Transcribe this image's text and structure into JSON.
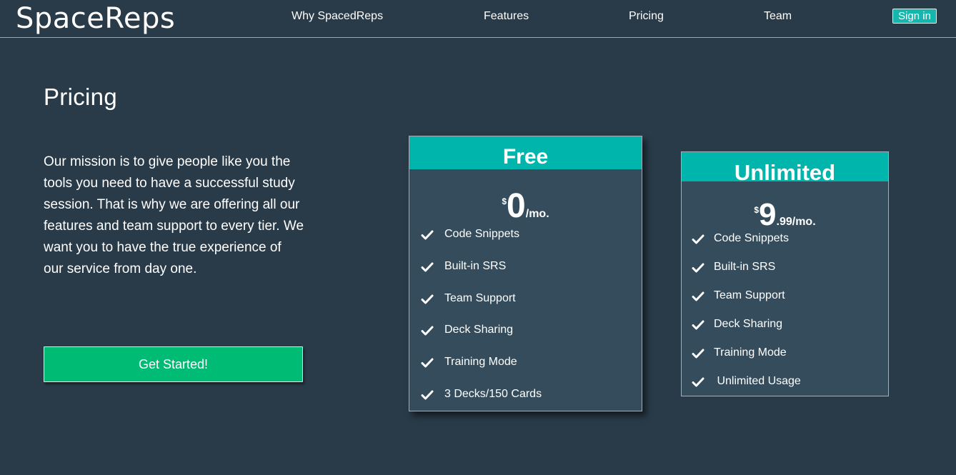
{
  "nav": {
    "logo": "SpaceReps",
    "links": [
      "Why SpacedReps",
      "Features",
      "Pricing",
      "Team"
    ],
    "sign_in": "Sign in"
  },
  "hero": {
    "title": "Pricing",
    "mission": "Our mission is to give people like you the tools you need to have a successful study session. That is why we are offering all our features and team support to every tier. We want you to have the true experience of our service from day one.",
    "cta": "Get Started!"
  },
  "plans": [
    {
      "name": "Free",
      "currency": "$",
      "amount": "0",
      "per": "/mo.",
      "features": [
        "Code Snippets",
        "Built-in SRS",
        "Team Support",
        "Deck Sharing",
        "Training Mode",
        "3 Decks/150 Cards"
      ]
    },
    {
      "name": "Unlimited",
      "currency": "$",
      "amount": "9",
      "per": ".99/mo.",
      "features": [
        "Code Snippets",
        "Built-in SRS",
        "Team Support",
        "Deck Sharing",
        "Training Mode",
        " Unlimited Usage"
      ]
    }
  ],
  "colors": {
    "background": "#293a48",
    "card": "#344c5b",
    "accent": "#00b5ac",
    "cta": "#00bb73"
  },
  "icons": {
    "feature": "check-icon"
  }
}
